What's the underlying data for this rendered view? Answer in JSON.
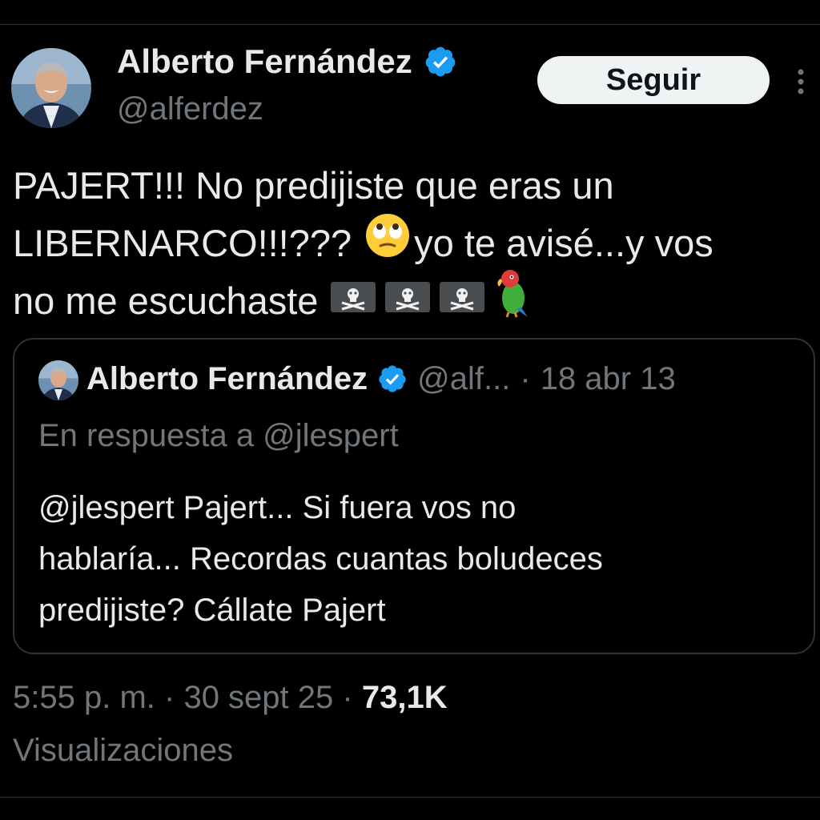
{
  "author": {
    "display_name": "Alberto Fernández",
    "handle": "@alferdez",
    "verified_icon": "verified-badge-icon",
    "avatar_icon": "profile-avatar"
  },
  "header": {
    "follow_label": "Seguir",
    "more_icon": "more-vertical-icon"
  },
  "tweet": {
    "line1": "PAJERT!!! No predijiste que eras un",
    "line2_a": "LIBERNARCO!!!???",
    "line2_b": "yo te avisé...y vos",
    "line3": "no me escuchaste",
    "emojis": [
      "face-with-rolling-eyes",
      "pirate-flag",
      "pirate-flag",
      "pirate-flag",
      "parrot"
    ]
  },
  "quote": {
    "display_name": "Alberto Fernández",
    "handle": "@alf...",
    "separator": "·",
    "date": "18 abr 13",
    "reply_to": "En respuesta a @jlespert",
    "text_line1": "@jlespert Pajert... Si fuera vos no",
    "text_line2": "hablaría... Recordas cuantas boludeces",
    "text_line3": "predijiste? Cállate Pajert"
  },
  "meta": {
    "time": "5:55 p. m.",
    "sep1": "·",
    "date": "30 sept 25",
    "sep2": "·",
    "views": "73,1K",
    "views_label": "Visualizaciones"
  },
  "colors": {
    "background": "#000000",
    "text_primary": "#e7e9ea",
    "text_secondary": "#71767b",
    "verified_blue": "#1d9bf0",
    "border": "#2f3336",
    "button_bg": "#eff3f4"
  }
}
